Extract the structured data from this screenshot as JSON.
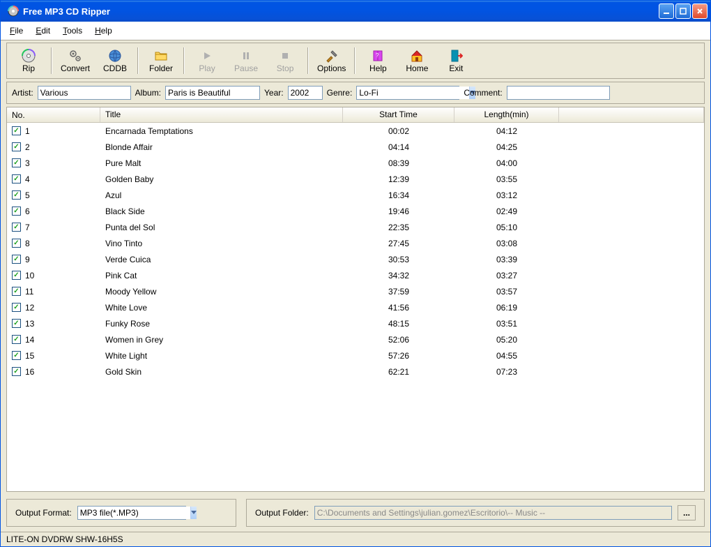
{
  "window": {
    "title": "Free MP3 CD Ripper"
  },
  "menubar": {
    "file": "File",
    "edit": "Edit",
    "tools": "Tools",
    "help": "Help"
  },
  "toolbar": {
    "rip": "Rip",
    "convert": "Convert",
    "cddb": "CDDB",
    "folder": "Folder",
    "play": "Play",
    "pause": "Pause",
    "stop": "Stop",
    "options": "Options",
    "help": "Help",
    "home": "Home",
    "exit": "Exit"
  },
  "meta": {
    "artist_label": "Artist:",
    "artist_value": "Various",
    "album_label": "Album:",
    "album_value": "Paris is Beautiful",
    "year_label": "Year:",
    "year_value": "2002",
    "genre_label": "Genre:",
    "genre_value": "Lo-Fi",
    "comment_label": "Comment:",
    "comment_value": ""
  },
  "columns": {
    "no": "No.",
    "title": "Title",
    "start": "Start Time",
    "length": "Length(min)"
  },
  "tracks": [
    {
      "no": "1",
      "title": "Encarnada Temptations",
      "start": "00:02",
      "length": "04:12"
    },
    {
      "no": "2",
      "title": "Blonde Affair",
      "start": "04:14",
      "length": "04:25"
    },
    {
      "no": "3",
      "title": "Pure Malt",
      "start": "08:39",
      "length": "04:00"
    },
    {
      "no": "4",
      "title": "Golden Baby",
      "start": "12:39",
      "length": "03:55"
    },
    {
      "no": "5",
      "title": "Azul",
      "start": "16:34",
      "length": "03:12"
    },
    {
      "no": "6",
      "title": "Black Side",
      "start": "19:46",
      "length": "02:49"
    },
    {
      "no": "7",
      "title": "Punta del Sol",
      "start": "22:35",
      "length": "05:10"
    },
    {
      "no": "8",
      "title": "Vino Tinto",
      "start": "27:45",
      "length": "03:08"
    },
    {
      "no": "9",
      "title": "Verde Cuica",
      "start": "30:53",
      "length": "03:39"
    },
    {
      "no": "10",
      "title": "Pink Cat",
      "start": "34:32",
      "length": "03:27"
    },
    {
      "no": "11",
      "title": "Moody Yellow",
      "start": "37:59",
      "length": "03:57"
    },
    {
      "no": "12",
      "title": "White Love",
      "start": "41:56",
      "length": "06:19"
    },
    {
      "no": "13",
      "title": "Funky Rose",
      "start": "48:15",
      "length": "03:51"
    },
    {
      "no": "14",
      "title": "Women in Grey",
      "start": "52:06",
      "length": "05:20"
    },
    {
      "no": "15",
      "title": "White Light",
      "start": "57:26",
      "length": "04:55"
    },
    {
      "no": "16",
      "title": "Gold Skin",
      "start": "62:21",
      "length": "07:23"
    }
  ],
  "output": {
    "format_label": "Output Format:",
    "format_value": "MP3 file(*.MP3)",
    "folder_label": "Output Folder:",
    "folder_value": "C:\\Documents and Settings\\julian.gomez\\Escritorio\\-- Music --"
  },
  "statusbar": "LITE-ON DVDRW SHW-16H5S"
}
